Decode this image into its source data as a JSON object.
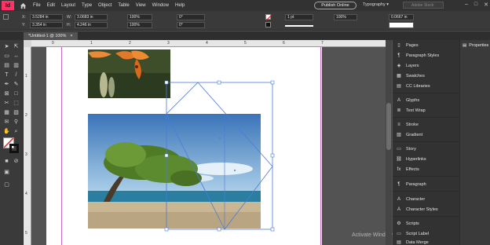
{
  "app": {
    "logo": "Id"
  },
  "menu": [
    "File",
    "Edit",
    "Layout",
    "Type",
    "Object",
    "Table",
    "View",
    "Window",
    "Help"
  ],
  "header": {
    "publish_label": "Publish Online",
    "workspace": "Typography",
    "search_placeholder": "Adobe Stock"
  },
  "control": {
    "x_label": "X:",
    "x_value": "3.5284 in",
    "y_label": "Y:",
    "y_value": "3.354 in",
    "w_label": "W:",
    "w_value": "3.0683 in",
    "h_label": "H:",
    "h_value": "4.246 in",
    "scale_x": "100%",
    "scale_y": "100%",
    "rotate": "0°",
    "shear": "0°",
    "stroke_weight": "1 pt",
    "opacity": "100%",
    "width_value": "0.0667 in"
  },
  "tab": {
    "title": "*Untitled-1 @ 100%",
    "close": "×"
  },
  "ruler": {
    "h": [
      "0",
      "1",
      "2",
      "3",
      "4",
      "5",
      "6",
      "7"
    ],
    "v": [
      "1",
      "2",
      "3",
      "4",
      "5"
    ]
  },
  "panels": {
    "properties_label": "Properties",
    "items": [
      {
        "label": "Pages",
        "icon": "pages-icon"
      },
      {
        "label": "Paragraph Styles",
        "icon": "paragraph-styles-icon"
      },
      {
        "label": "Layers",
        "icon": "layers-icon"
      },
      {
        "label": "Swatches",
        "icon": "swatches-icon"
      },
      {
        "label": "CC Libraries",
        "icon": "cc-libraries-icon"
      },
      {
        "label": "Glyphs",
        "icon": "glyphs-icon"
      },
      {
        "label": "Text Wrap",
        "icon": "text-wrap-icon"
      },
      {
        "label": "Stroke",
        "icon": "stroke-icon"
      },
      {
        "label": "Gradient",
        "icon": "gradient-icon"
      },
      {
        "label": "Story",
        "icon": "story-icon"
      },
      {
        "label": "Hyperlinks",
        "icon": "hyperlinks-icon"
      },
      {
        "label": "Effects",
        "icon": "effects-icon"
      },
      {
        "label": "Paragraph",
        "icon": "paragraph-icon"
      },
      {
        "label": "Character",
        "icon": "character-icon"
      },
      {
        "label": "Character Styles",
        "icon": "character-styles-icon"
      },
      {
        "label": "Scripts",
        "icon": "scripts-icon"
      },
      {
        "label": "Script Label",
        "icon": "script-label-icon"
      },
      {
        "label": "Data Merge",
        "icon": "data-merge-icon"
      }
    ]
  },
  "watermark": "Activate Windows",
  "colors": {
    "accent": "#ff3366",
    "selection": "#4a7bd8",
    "margin_guide": "#c86ac8"
  }
}
